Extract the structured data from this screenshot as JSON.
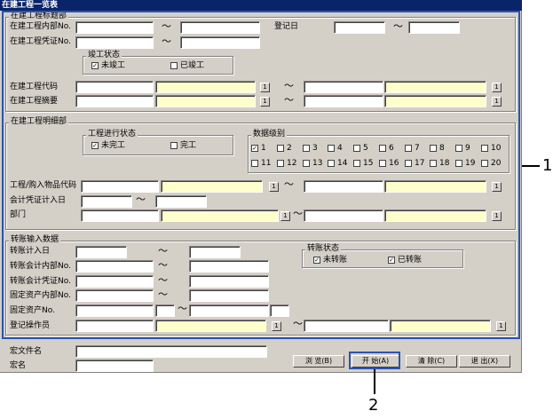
{
  "window": {
    "title": "在建工程一览表"
  },
  "header_section": {
    "title": "在建工程标题部",
    "internal_no_label": "在建工程内部No.",
    "voucher_no_label": "在建工程凭证No.",
    "register_date_label": "登记日",
    "tilde": "～",
    "completion_group": {
      "title": "竣工状态",
      "not_completed_label": "未竣工",
      "not_completed_checked": true,
      "completed_label": "已竣工",
      "completed_checked": false
    },
    "code_label": "在建工程代码",
    "summary_label": "在建工程摘要",
    "lookup": "1"
  },
  "detail_section": {
    "title": "在建工程明细部",
    "progress_group": {
      "title": "工程进行状态",
      "incomplete_label": "未完工",
      "incomplete_checked": true,
      "complete_label": "完工",
      "complete_checked": false
    },
    "data_level_group": {
      "title": "数据级别",
      "levels": [
        {
          "label": "1",
          "checked": true
        },
        {
          "label": "2",
          "checked": false
        },
        {
          "label": "3",
          "checked": false
        },
        {
          "label": "4",
          "checked": false
        },
        {
          "label": "5",
          "checked": false
        },
        {
          "label": "6",
          "checked": false
        },
        {
          "label": "7",
          "checked": false
        },
        {
          "label": "8",
          "checked": false
        },
        {
          "label": "9",
          "checked": false
        },
        {
          "label": "10",
          "checked": false
        },
        {
          "label": "11",
          "checked": false
        },
        {
          "label": "12",
          "checked": false
        },
        {
          "label": "13",
          "checked": false
        },
        {
          "label": "14",
          "checked": false
        },
        {
          "label": "15",
          "checked": false
        },
        {
          "label": "16",
          "checked": false
        },
        {
          "label": "17",
          "checked": false
        },
        {
          "label": "18",
          "checked": false
        },
        {
          "label": "19",
          "checked": false
        },
        {
          "label": "20",
          "checked": false
        }
      ]
    },
    "item_code_label": "工程/购入物品代码",
    "accounting_date_label": "会计凭证计入日",
    "department_label": "部门"
  },
  "transfer_section": {
    "title": "转账输入数据",
    "transfer_date_label": "转账计入日",
    "accounting_internal_label": "转账会计内部No.",
    "accounting_voucher_label": "转账会计凭证No.",
    "asset_internal_label": "固定资产内部No.",
    "asset_no_label": "固定资产No.",
    "operator_label": "登记操作员",
    "transfer_status_group": {
      "title": "转账状态",
      "not_transferred_label": "未转账",
      "not_transferred_checked": true,
      "transferred_label": "已转账",
      "transferred_checked": true
    }
  },
  "footer": {
    "macro_file_label": "宏文件名",
    "macro_name_label": "宏名",
    "browse_button": "浏 览(B)",
    "start_button": "开 始(A)",
    "clear_button": "清 除(C)",
    "exit_button": "退 出(X)"
  },
  "callouts": {
    "one": "1",
    "two": "2"
  }
}
